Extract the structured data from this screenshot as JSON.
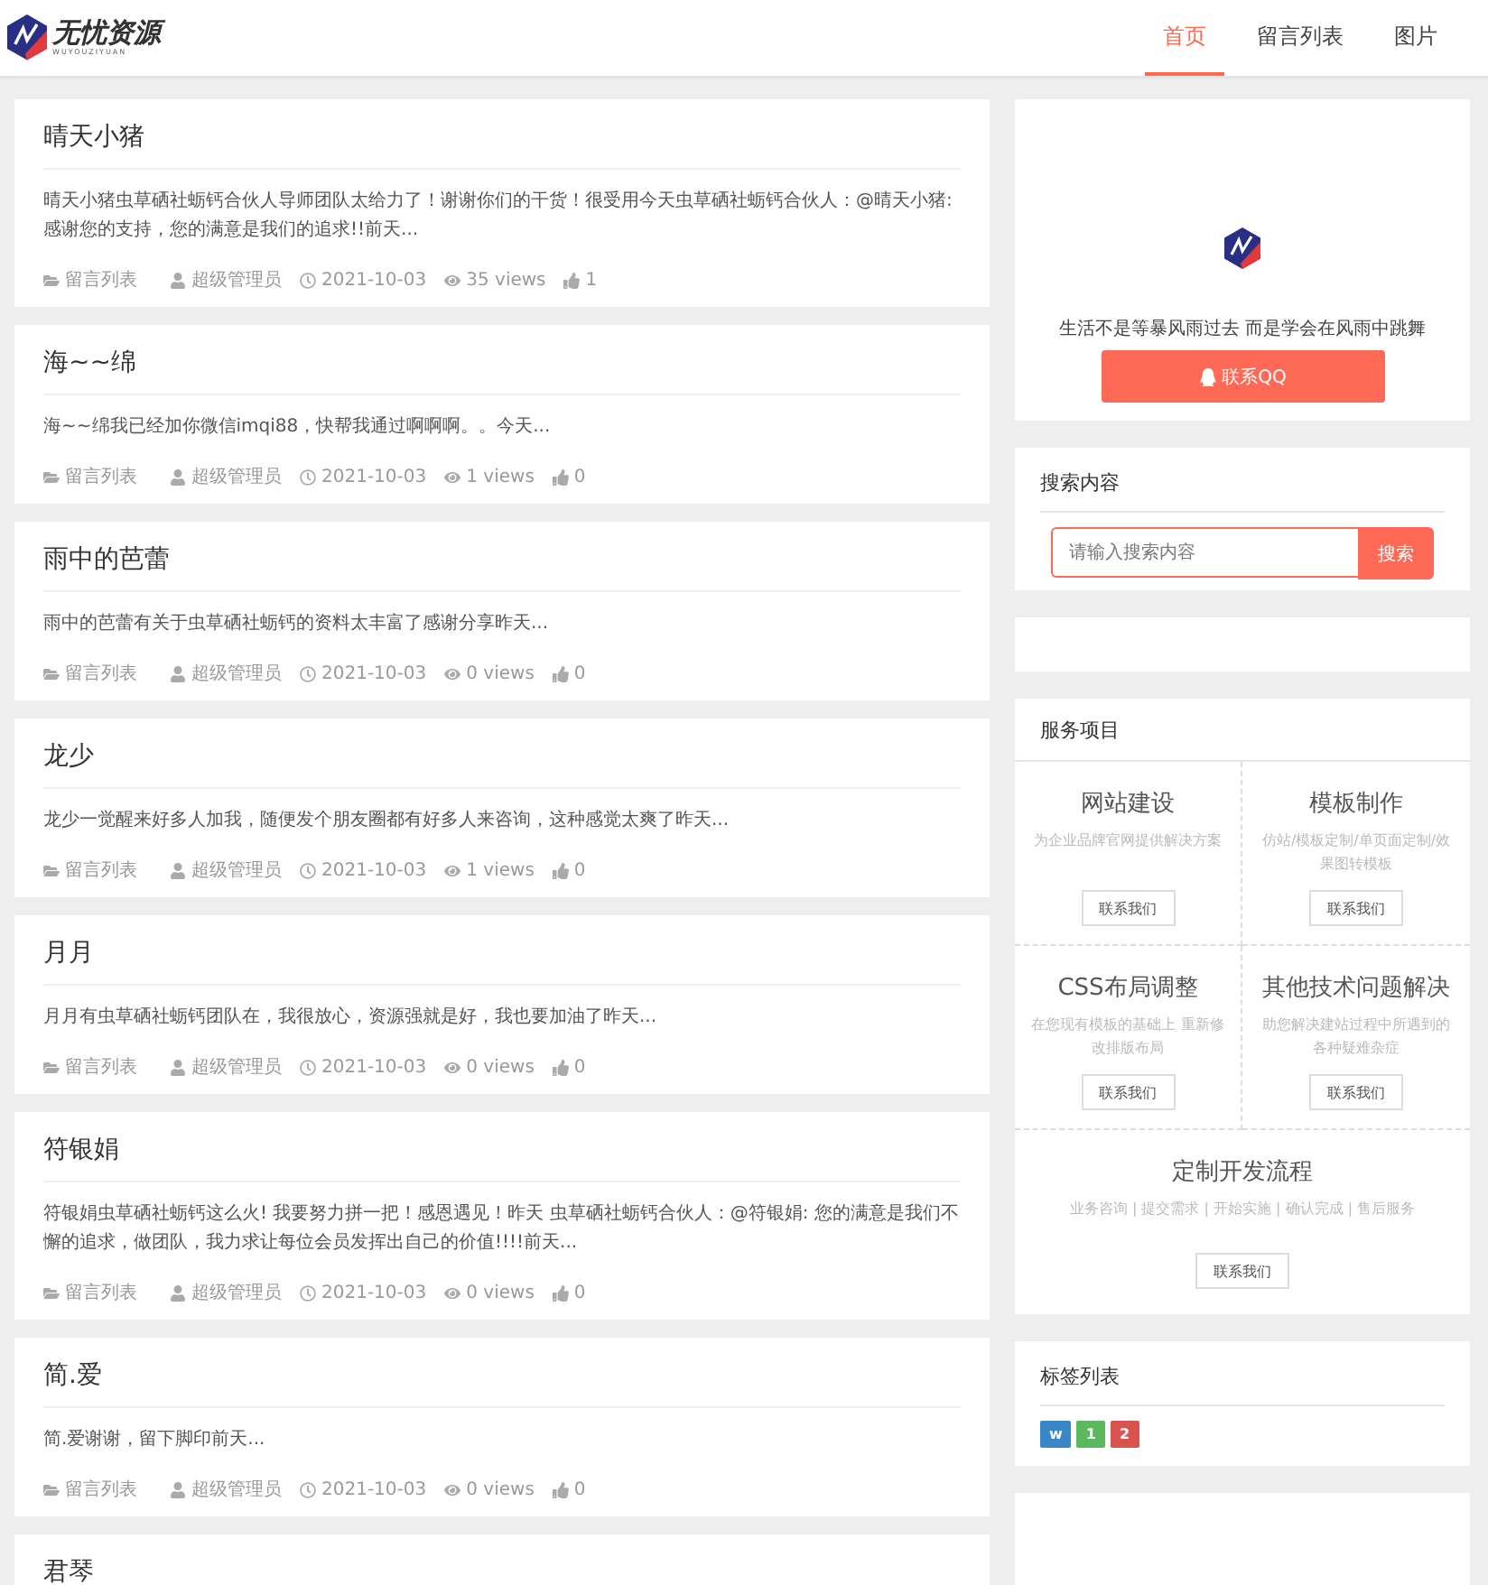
{
  "header": {
    "logo_text": "无忧资源",
    "logo_subtext": "WUYOUZIYUAN",
    "nav": [
      {
        "label": "首页",
        "selected": true
      },
      {
        "label": "留言列表",
        "selected": false
      },
      {
        "label": "图片",
        "selected": false
      }
    ]
  },
  "posts": [
    {
      "title": "晴天小猪",
      "excerpt": "晴天小猪虫草硒社蛎钙合伙人导师团队太给力了！谢谢你们的干货！很受用今天虫草硒社蛎钙合伙人：@晴天小猪:感谢您的支持，您的满意是我们的追求!!前天...",
      "category": "留言列表",
      "author": "超级管理员",
      "date": "2021-10-03",
      "views": "35 views",
      "likes": "1"
    },
    {
      "title": "海~~绵",
      "excerpt": "海~~绵我已经加你微信imqi88，快帮我通过啊啊啊。。今天...",
      "category": "留言列表",
      "author": "超级管理员",
      "date": "2021-10-03",
      "views": "1 views",
      "likes": "0"
    },
    {
      "title": "雨中的芭蕾",
      "excerpt": "雨中的芭蕾有关于虫草硒社蛎钙的资料太丰富了感谢分享昨天...",
      "category": "留言列表",
      "author": "超级管理员",
      "date": "2021-10-03",
      "views": "0 views",
      "likes": "0"
    },
    {
      "title": "龙少",
      "excerpt": "龙少一觉醒来好多人加我，随便发个朋友圈都有好多人来咨询，这种感觉太爽了昨天...",
      "category": "留言列表",
      "author": "超级管理员",
      "date": "2021-10-03",
      "views": "1 views",
      "likes": "0"
    },
    {
      "title": "月月",
      "excerpt": "月月有虫草硒社蛎钙团队在，我很放心，资源强就是好，我也要加油了昨天...",
      "category": "留言列表",
      "author": "超级管理员",
      "date": "2021-10-03",
      "views": "0 views",
      "likes": "0"
    },
    {
      "title": "符银娟",
      "excerpt": "符银娟虫草硒社蛎钙这么火! 我要努力拼一把！感恩遇见！昨天 虫草硒社蛎钙合伙人：@符银娟: 您的满意是我们不懈的追求，做团队，我力求让每位会员发挥出自己的价值!!!!前天...",
      "category": "留言列表",
      "author": "超级管理员",
      "date": "2021-10-03",
      "views": "0 views",
      "likes": "0"
    },
    {
      "title": "简.爱",
      "excerpt": "简.爱谢谢，留下脚印前天...",
      "category": "留言列表",
      "author": "超级管理员",
      "date": "2021-10-03",
      "views": "0 views",
      "likes": "0"
    },
    {
      "title": "君琴"
    }
  ],
  "profile": {
    "motto": "生活不是等暴风雨过去 而是学会在风雨中跳舞",
    "qq_button": "联系QQ"
  },
  "search": {
    "title": "搜索内容",
    "placeholder": "请输入搜索内容",
    "button": "搜索"
  },
  "services": {
    "title": "服务项目",
    "items": [
      {
        "name": "网站建设",
        "desc": "为企业品牌官网提供解决方案",
        "button": "联系我们"
      },
      {
        "name": "模板制作",
        "desc": "仿站/模板定制/单页面定制/效果图转模板",
        "button": "联系我们"
      },
      {
        "name": "CSS布局调整",
        "desc": "在您现有模板的基础上 重新修改排版布局",
        "button": "联系我们"
      },
      {
        "name": "其他技术问题解决",
        "desc": "助您解决建站过程中所遇到的各种疑难杂症",
        "button": "联系我们"
      }
    ],
    "process": {
      "name": "定制开发流程",
      "desc": "业务咨询 | 提交需求 | 开始实施 | 确认完成 | 售后服务",
      "button": "联系我们"
    }
  },
  "tags": {
    "title": "标签列表",
    "items": [
      {
        "label": "w",
        "color": "#3a87c8"
      },
      {
        "label": "1",
        "color": "#5cb85c"
      },
      {
        "label": "2",
        "color": "#d9534f"
      }
    ]
  }
}
